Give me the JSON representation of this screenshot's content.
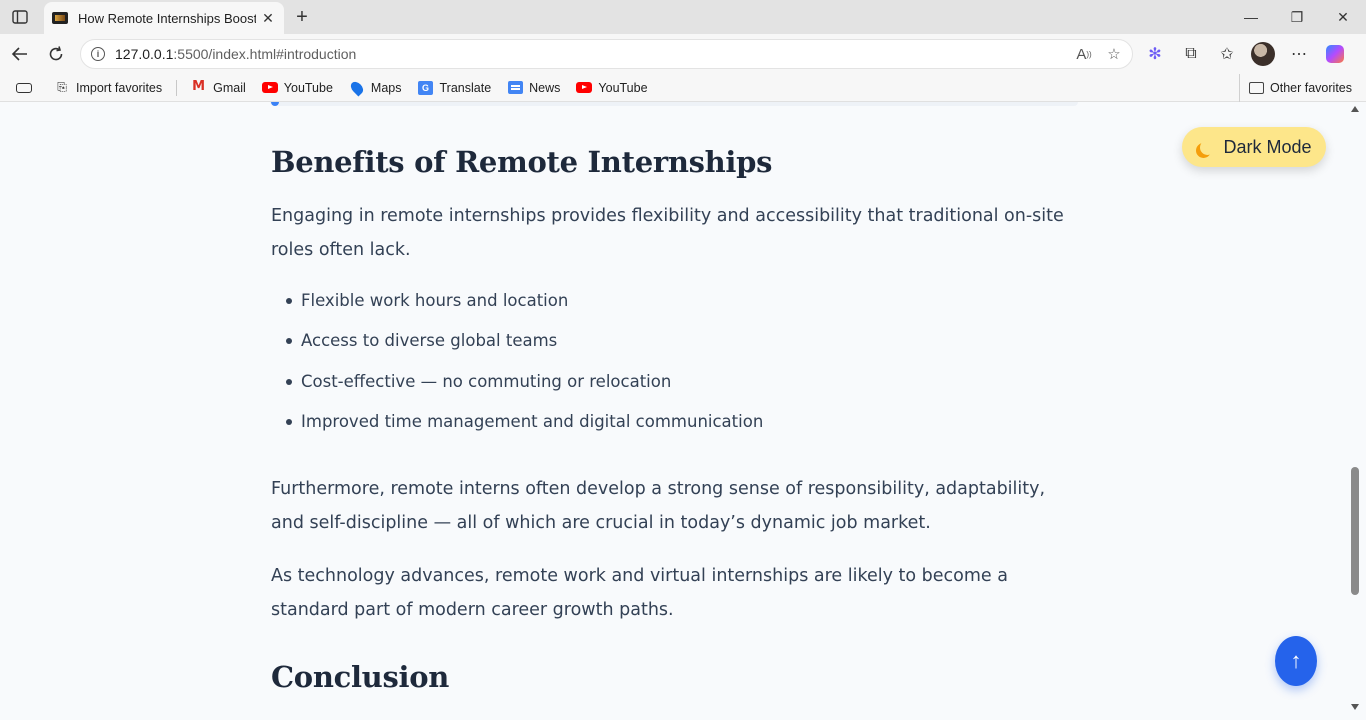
{
  "browser": {
    "tab_title": "How Remote Internships Boost Career",
    "url_host": "127.0.0.1",
    "url_rest": ":5500/index.html#introduction",
    "new_tab_symbol": "+",
    "close_symbol": "✕",
    "win_minimize": "—",
    "win_restore": "❐",
    "win_close": "✕"
  },
  "favorites": {
    "import": "Import favorites",
    "items": [
      "Gmail",
      "YouTube",
      "Maps",
      "Translate",
      "News",
      "YouTube"
    ],
    "other": "Other favorites"
  },
  "page": {
    "benefits_heading": "Benefits of Remote Internships",
    "benefits_intro": "Engaging in remote internships provides flexibility and accessibility that traditional on-site roles often lack.",
    "benefits": [
      "Flexible work hours and location",
      "Access to diverse global teams",
      "Cost-effective — no commuting or relocation",
      "Improved time management and digital communication"
    ],
    "paragraph_furthermore": "Furthermore, remote interns often develop a strong sense of responsibility, adaptability, and self-discipline — all of which are crucial in today’s dynamic job market.",
    "paragraph_technology": "As technology advances, remote work and virtual internships are likely to become a standard part of modern career growth paths.",
    "conclusion_heading": "Conclusion",
    "dark_mode_label": "Dark Mode",
    "back_to_top_symbol": "↑"
  },
  "colors": {
    "accent": "#2563eb",
    "toggle_bg": "#fde68a",
    "heading": "#1e293b",
    "text": "#334155",
    "page_bg": "#f8fafc"
  },
  "icons": [
    "sidebar-toggle-icon",
    "back-icon",
    "refresh-icon",
    "info-icon",
    "read-aloud-icon",
    "star-icon",
    "copilot-icon",
    "extensions-icon",
    "favorites-icon",
    "more-icon",
    "moon-icon",
    "arrow-up-icon"
  ]
}
